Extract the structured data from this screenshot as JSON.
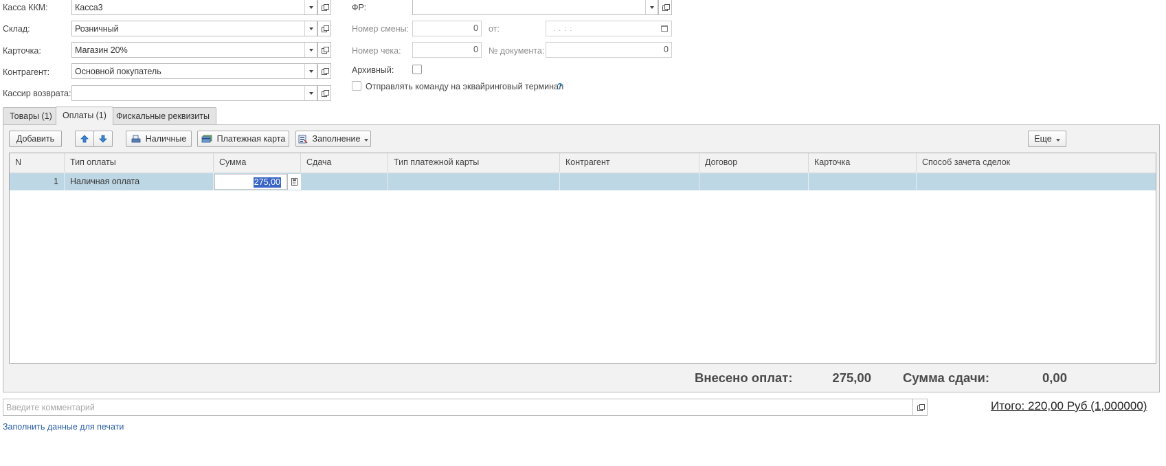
{
  "left_fields": {
    "kassa": {
      "label": "Касса ККМ:",
      "value": "Касса3"
    },
    "sklad": {
      "label": "Склад:",
      "value": "Розничный"
    },
    "kartochka": {
      "label": "Карточка:",
      "value": "Магазин 20%"
    },
    "kontragent": {
      "label": "Контрагент:",
      "value": "Основной покупатель"
    },
    "kassir": {
      "label": "Кассир возврата:",
      "value": ""
    }
  },
  "right_fields": {
    "fr": {
      "label": "ФР:",
      "value": ""
    },
    "nomer_smeny": {
      "label": "Номер смены:",
      "value": "0"
    },
    "ot": {
      "label": "от:",
      "value": " .  .       :  :"
    },
    "nomer_cheka": {
      "label": "Номер чека:",
      "value": "0"
    },
    "nomer_doc": {
      "label": "№ документа:",
      "value": "0"
    },
    "arhivny": {
      "label": "Архивный:"
    },
    "acquiring": {
      "label": "Отправлять команду на эквайринговый терминал",
      "help": "?"
    }
  },
  "tabs": [
    {
      "label": "Товары (1)"
    },
    {
      "label": "Оплаты (1)"
    },
    {
      "label": "Фискальные реквизиты"
    }
  ],
  "toolbar": {
    "add": "Добавить",
    "cash": "Наличные",
    "card": "Платежная карта",
    "fill": "Заполнение",
    "more": "Еще"
  },
  "table": {
    "columns": [
      "N",
      "Тип оплаты",
      "Сумма",
      "Сдача",
      "Тип платежной карты",
      "Контрагент",
      "Договор",
      "Карточка",
      "Способ зачета сделок"
    ],
    "rows": [
      {
        "n": "1",
        "type": "Наличная оплата",
        "sum": "275,00",
        "change": "",
        "card_type": "",
        "kontragent": "",
        "dogovor": "",
        "kartochka": "",
        "sposob": ""
      }
    ]
  },
  "totals": {
    "paid_label": "Внесено оплат:",
    "paid_value": "275,00",
    "change_label": "Сумма сдачи:",
    "change_value": "0,00"
  },
  "footer": {
    "comment_placeholder": "Введите комментарий",
    "itogo": "Итого: 220,00 Руб (1,000000)",
    "print_link": "Заполнить данные для печати"
  }
}
